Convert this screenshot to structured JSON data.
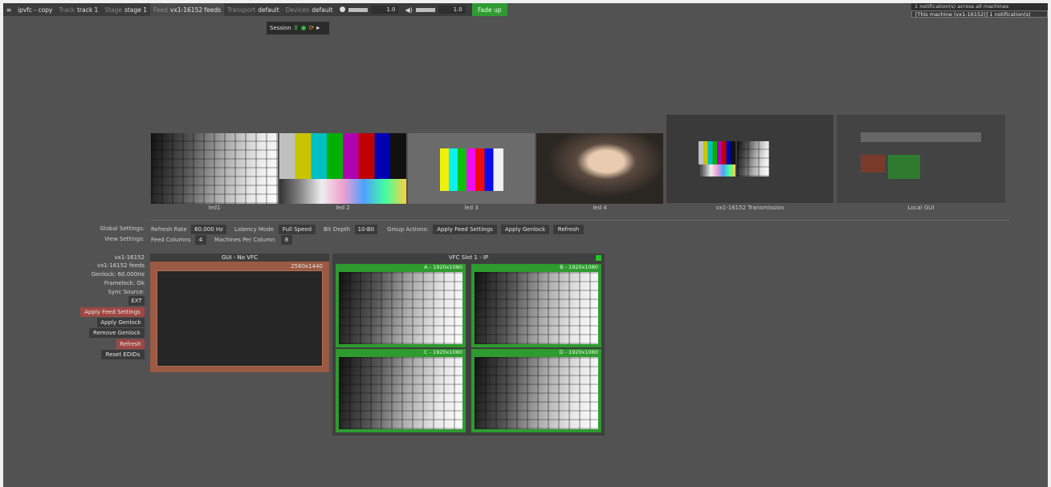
{
  "topbar": {
    "project": "ipvfc - copy",
    "track_key": "Track",
    "track_val": "track 1",
    "stage_key": "Stage",
    "stage_val": "stage 1",
    "feed_key": "Feed",
    "feed_val": "vx1-16152 feeds",
    "transport_key": "Transport",
    "transport_val": "default",
    "devices_key": "Devices",
    "devices_val": "default",
    "brightness_value": "1.0",
    "volume_value": "1.0",
    "fade_label": "Fade up"
  },
  "notifications": [
    "1 notification(s) across all machines",
    "[This machine (vx1-16152)] 1 notification(s)"
  ],
  "session": {
    "label": "Session"
  },
  "feeds": [
    {
      "label": "led1"
    },
    {
      "label": "led 2"
    },
    {
      "label": "led 3"
    },
    {
      "label": "led 4"
    },
    {
      "label": "vx1-16152 Transmission"
    },
    {
      "label": "Local GUI"
    }
  ],
  "global_settings": {
    "label": "Global Settings:",
    "refresh_rate_label": "Refresh Rate",
    "refresh_rate_value": "60.000 Hz",
    "latency_mode_label": "Latency Mode",
    "latency_mode_value": "Full Speed",
    "bit_depth_label": "Bit Depth",
    "bit_depth_value": "10-Bit",
    "group_actions_label": "Group Actions:",
    "apply_feed_settings": "Apply Feed Settings",
    "apply_genlock": "Apply Genlock",
    "refresh": "Refresh"
  },
  "view_settings": {
    "label": "View Settings:",
    "feed_columns_label": "Feed Columns",
    "feed_columns_value": "4",
    "machines_per_column_label": "Machines Per Column",
    "machines_per_column_value": "8"
  },
  "machine": {
    "name": "vx1-16152",
    "feeds": "vx1-16152 feeds",
    "genlock": "Genlock: 60.000Hz",
    "framelock": "Framelock: Ok",
    "sync_source": "Sync Source:",
    "sync_value": "EXT",
    "buttons": {
      "apply_feed_settings": "Apply Feed Settings",
      "apply_genlock": "Apply Genlock",
      "remove_genlock": "Remove Genlock",
      "refresh": "Refresh",
      "reset_edids": "Reset EDIDs"
    }
  },
  "gui_panel": {
    "title": "GUI - No VFC",
    "resolution": "2560x1440"
  },
  "vfc_panel": {
    "title": "VFC Slot 1 - IP",
    "outputs": [
      {
        "label": "A - 1920x1080"
      },
      {
        "label": "B - 1920x1080"
      },
      {
        "label": "C - 1920x1080"
      },
      {
        "label": "D - 1920x1080"
      }
    ]
  },
  "colors": {
    "accent_green": "#2e9b2e",
    "accent_red": "#a04743",
    "gui_orange": "#9a5a44",
    "background": "#525252"
  }
}
